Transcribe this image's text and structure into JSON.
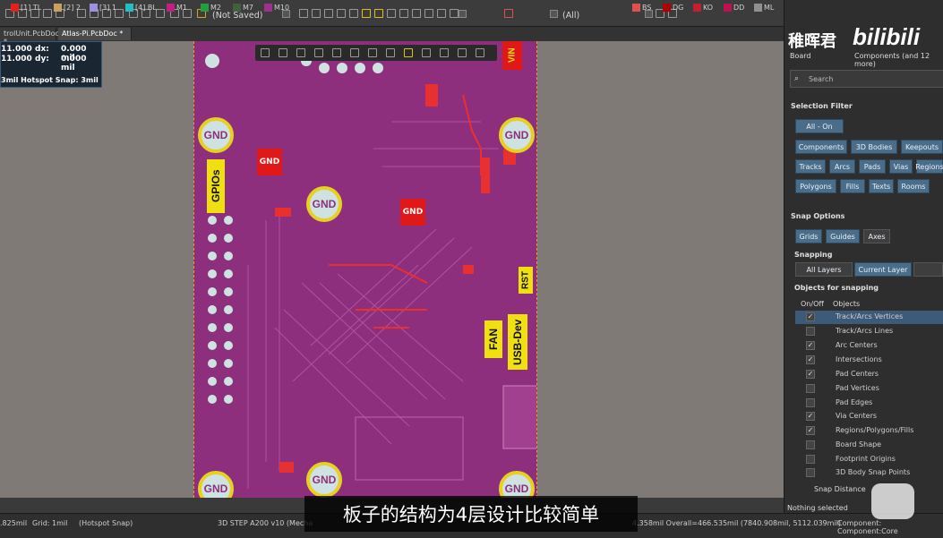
{
  "toolbar": {
    "status": "(Not Saved)",
    "filter": "(All)"
  },
  "tabs": [
    {
      "label": "trolUnit.PcbDoc *"
    },
    {
      "label": "Atlas-Pi.PcbDoc *"
    }
  ],
  "hud": {
    "x_label": "11.000",
    "dx_label": "dx:",
    "dx_val": "0.000 mil",
    "y_label": "11.000",
    "dy_label": "dy:",
    "dy_val": "0.000 mil",
    "snap": "3mil Hotspot Snap: 3mil"
  },
  "board": {
    "gnd": "GND",
    "gpios": "GPIOs",
    "rst": "RST",
    "fan": "FAN",
    "usb": "USB-Dev",
    "vin": "VIN",
    "chip1": "GND",
    "chip2": "GND"
  },
  "watermark": {
    "user": "稚晖君",
    "logo": "bilibili"
  },
  "panel": {
    "board_label": "Board",
    "components_label": "Components (and 12 more)",
    "search_placeholder": "Search",
    "selection_filter": "Selection Filter",
    "all_on": "All - On",
    "filters": [
      "Components",
      "3D Bodies",
      "Keepouts",
      "Tracks",
      "Arcs",
      "Pads",
      "Vias",
      "Regions",
      "Polygons",
      "Fills",
      "Texts",
      "Rooms"
    ],
    "snap_options": "Snap Options",
    "snap_modes": [
      "Grids",
      "Guides",
      "Axes"
    ],
    "snapping": "Snapping",
    "all_layers": "All Layers",
    "current_layer": "Current Layer",
    "objects_for_snapping": "Objects for snapping",
    "col_onoff": "On/Off",
    "col_objects": "Objects",
    "objects": [
      {
        "label": "Track/Arcs Vertices",
        "on": "✓"
      },
      {
        "label": "Track/Arcs Lines",
        "on": ""
      },
      {
        "label": "Arc Centers",
        "on": "✓"
      },
      {
        "label": "Intersections",
        "on": "✓"
      },
      {
        "label": "Pad Centers",
        "on": "✓"
      },
      {
        "label": "Pad Vertices",
        "on": ""
      },
      {
        "label": "Pad Edges",
        "on": ""
      },
      {
        "label": "Via Centers",
        "on": "✓"
      },
      {
        "label": "Regions/Polygons/Fills",
        "on": "✓"
      },
      {
        "label": "Board Shape",
        "on": ""
      },
      {
        "label": "Footprint Origins",
        "on": ""
      },
      {
        "label": "3D Body Snap Points",
        "on": ""
      }
    ],
    "snap_distance": "Snap Distance",
    "nothing_selected": "Nothing selected"
  },
  "layers": [
    {
      "label": "[1] TL",
      "color": "#e52020"
    },
    {
      "label": "[2] 2",
      "color": "#c8a060"
    },
    {
      "label": "[3] 1",
      "color": "#a090e0"
    },
    {
      "label": "[4] BL",
      "color": "#20c0c0"
    },
    {
      "label": "M1",
      "color": "#c02080"
    },
    {
      "label": "M2",
      "color": "#20a040"
    },
    {
      "label": "M7",
      "color": "#406040"
    },
    {
      "label": "M10",
      "color": "#a03090"
    },
    {
      "label": "BS",
      "color": "#e05050"
    },
    {
      "label": "DG",
      "color": "#b00000"
    },
    {
      "label": "KO",
      "color": "#c02030"
    },
    {
      "label": "DD",
      "color": "#c01050"
    },
    {
      "label": "ML",
      "color": "#909090"
    }
  ],
  "status": {
    "coord": ".825mil",
    "grid": "Grid: 1mil",
    "hotspot": "(Hotspot Snap)",
    "step": "3D STEP A200 v10 (Mecha",
    "overall": "4.358mil  Overall=466.535mil  (7840.908mil, 5112.039mil)",
    "component": "Component: Component:Core"
  },
  "subtitle": "板子的结构为4层设计比较简单"
}
